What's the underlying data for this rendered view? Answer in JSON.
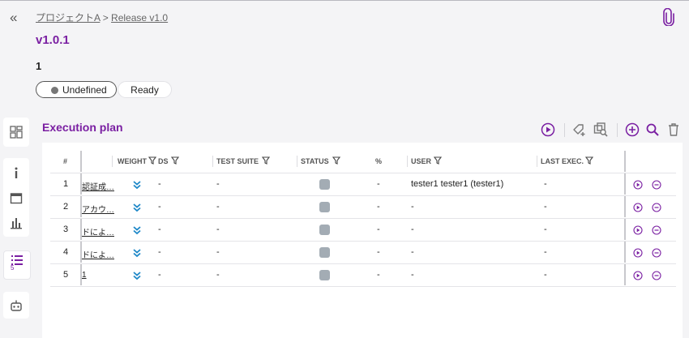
{
  "breadcrumb": {
    "project": "プロジェクトA",
    "separator": ">",
    "release": "Release v1.0"
  },
  "title": "v1.0.1",
  "description": "1",
  "status_pills": {
    "undefined": "Undefined",
    "ready": "Ready"
  },
  "sidebar": {
    "plan_count": "5"
  },
  "execution_plan": {
    "title": "Execution plan",
    "columns": {
      "index": "#",
      "weight": "WEIGHT",
      "ds": "DS",
      "test_suite": "TEST SUITE",
      "status": "STATUS",
      "percent": "%",
      "user": "USER",
      "last_exec": "LAST EXEC."
    },
    "rows": [
      {
        "n": "1",
        "name": "認証成…",
        "ds": "-",
        "suite": "-",
        "percent": "-",
        "user": "tester1 tester1 (tester1)",
        "last": "-"
      },
      {
        "n": "2",
        "name": "アカウ…",
        "ds": "-",
        "suite": "-",
        "percent": "-",
        "user": "-",
        "last": "-"
      },
      {
        "n": "3",
        "name": "ドによ…",
        "ds": "-",
        "suite": "-",
        "percent": "-",
        "user": "-",
        "last": "-"
      },
      {
        "n": "4",
        "name": "ドによ…",
        "ds": "-",
        "suite": "-",
        "percent": "-",
        "user": "-",
        "last": "-"
      },
      {
        "n": "5",
        "name": "1",
        "ds": "-",
        "suite": "-",
        "percent": "-",
        "user": "-",
        "last": "-"
      }
    ]
  },
  "colors": {
    "accent": "#7a1fa2",
    "weight_icon": "#1e88c8",
    "status_gray": "#a3acb4"
  }
}
